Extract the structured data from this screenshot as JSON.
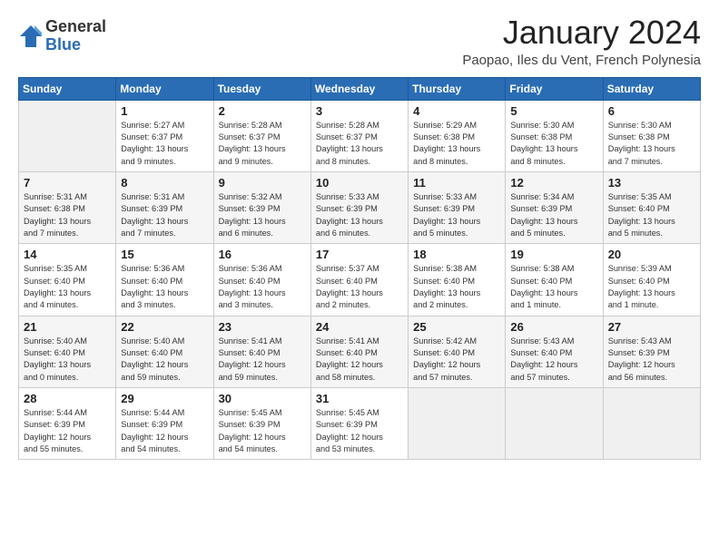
{
  "logo": {
    "general": "General",
    "blue": "Blue"
  },
  "header": {
    "title": "January 2024",
    "subtitle": "Paopao, Iles du Vent, French Polynesia"
  },
  "weekdays": [
    "Sunday",
    "Monday",
    "Tuesday",
    "Wednesday",
    "Thursday",
    "Friday",
    "Saturday"
  ],
  "weeks": [
    [
      {
        "day": "",
        "info": ""
      },
      {
        "day": "1",
        "info": "Sunrise: 5:27 AM\nSunset: 6:37 PM\nDaylight: 13 hours\nand 9 minutes."
      },
      {
        "day": "2",
        "info": "Sunrise: 5:28 AM\nSunset: 6:37 PM\nDaylight: 13 hours\nand 9 minutes."
      },
      {
        "day": "3",
        "info": "Sunrise: 5:28 AM\nSunset: 6:37 PM\nDaylight: 13 hours\nand 8 minutes."
      },
      {
        "day": "4",
        "info": "Sunrise: 5:29 AM\nSunset: 6:38 PM\nDaylight: 13 hours\nand 8 minutes."
      },
      {
        "day": "5",
        "info": "Sunrise: 5:30 AM\nSunset: 6:38 PM\nDaylight: 13 hours\nand 8 minutes."
      },
      {
        "day": "6",
        "info": "Sunrise: 5:30 AM\nSunset: 6:38 PM\nDaylight: 13 hours\nand 7 minutes."
      }
    ],
    [
      {
        "day": "7",
        "info": "Sunrise: 5:31 AM\nSunset: 6:38 PM\nDaylight: 13 hours\nand 7 minutes."
      },
      {
        "day": "8",
        "info": "Sunrise: 5:31 AM\nSunset: 6:39 PM\nDaylight: 13 hours\nand 7 minutes."
      },
      {
        "day": "9",
        "info": "Sunrise: 5:32 AM\nSunset: 6:39 PM\nDaylight: 13 hours\nand 6 minutes."
      },
      {
        "day": "10",
        "info": "Sunrise: 5:33 AM\nSunset: 6:39 PM\nDaylight: 13 hours\nand 6 minutes."
      },
      {
        "day": "11",
        "info": "Sunrise: 5:33 AM\nSunset: 6:39 PM\nDaylight: 13 hours\nand 5 minutes."
      },
      {
        "day": "12",
        "info": "Sunrise: 5:34 AM\nSunset: 6:39 PM\nDaylight: 13 hours\nand 5 minutes."
      },
      {
        "day": "13",
        "info": "Sunrise: 5:35 AM\nSunset: 6:40 PM\nDaylight: 13 hours\nand 5 minutes."
      }
    ],
    [
      {
        "day": "14",
        "info": "Sunrise: 5:35 AM\nSunset: 6:40 PM\nDaylight: 13 hours\nand 4 minutes."
      },
      {
        "day": "15",
        "info": "Sunrise: 5:36 AM\nSunset: 6:40 PM\nDaylight: 13 hours\nand 3 minutes."
      },
      {
        "day": "16",
        "info": "Sunrise: 5:36 AM\nSunset: 6:40 PM\nDaylight: 13 hours\nand 3 minutes."
      },
      {
        "day": "17",
        "info": "Sunrise: 5:37 AM\nSunset: 6:40 PM\nDaylight: 13 hours\nand 2 minutes."
      },
      {
        "day": "18",
        "info": "Sunrise: 5:38 AM\nSunset: 6:40 PM\nDaylight: 13 hours\nand 2 minutes."
      },
      {
        "day": "19",
        "info": "Sunrise: 5:38 AM\nSunset: 6:40 PM\nDaylight: 13 hours\nand 1 minute."
      },
      {
        "day": "20",
        "info": "Sunrise: 5:39 AM\nSunset: 6:40 PM\nDaylight: 13 hours\nand 1 minute."
      }
    ],
    [
      {
        "day": "21",
        "info": "Sunrise: 5:40 AM\nSunset: 6:40 PM\nDaylight: 13 hours\nand 0 minutes."
      },
      {
        "day": "22",
        "info": "Sunrise: 5:40 AM\nSunset: 6:40 PM\nDaylight: 12 hours\nand 59 minutes."
      },
      {
        "day": "23",
        "info": "Sunrise: 5:41 AM\nSunset: 6:40 PM\nDaylight: 12 hours\nand 59 minutes."
      },
      {
        "day": "24",
        "info": "Sunrise: 5:41 AM\nSunset: 6:40 PM\nDaylight: 12 hours\nand 58 minutes."
      },
      {
        "day": "25",
        "info": "Sunrise: 5:42 AM\nSunset: 6:40 PM\nDaylight: 12 hours\nand 57 minutes."
      },
      {
        "day": "26",
        "info": "Sunrise: 5:43 AM\nSunset: 6:40 PM\nDaylight: 12 hours\nand 57 minutes."
      },
      {
        "day": "27",
        "info": "Sunrise: 5:43 AM\nSunset: 6:39 PM\nDaylight: 12 hours\nand 56 minutes."
      }
    ],
    [
      {
        "day": "28",
        "info": "Sunrise: 5:44 AM\nSunset: 6:39 PM\nDaylight: 12 hours\nand 55 minutes."
      },
      {
        "day": "29",
        "info": "Sunrise: 5:44 AM\nSunset: 6:39 PM\nDaylight: 12 hours\nand 54 minutes."
      },
      {
        "day": "30",
        "info": "Sunrise: 5:45 AM\nSunset: 6:39 PM\nDaylight: 12 hours\nand 54 minutes."
      },
      {
        "day": "31",
        "info": "Sunrise: 5:45 AM\nSunset: 6:39 PM\nDaylight: 12 hours\nand 53 minutes."
      },
      {
        "day": "",
        "info": ""
      },
      {
        "day": "",
        "info": ""
      },
      {
        "day": "",
        "info": ""
      }
    ]
  ]
}
